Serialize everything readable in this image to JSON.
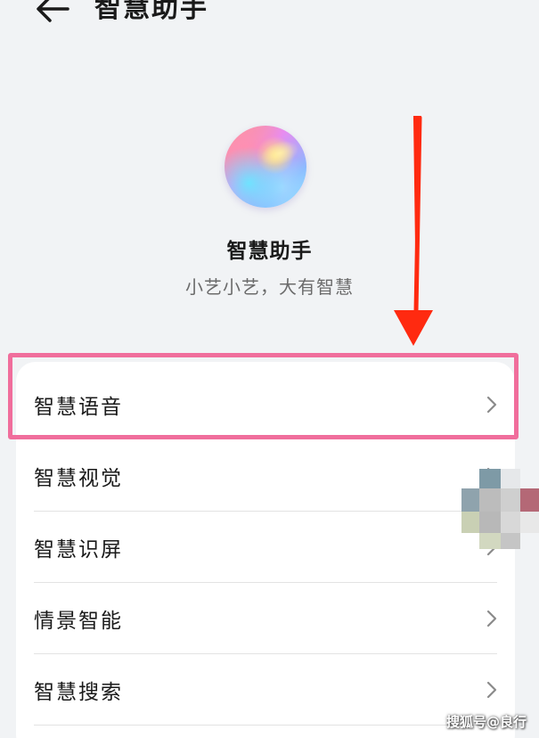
{
  "header": {
    "title": "智慧助手",
    "back_icon": "arrow-left-icon"
  },
  "app": {
    "name": "智慧助手",
    "subtitle": "小艺小艺，大有智慧",
    "logo_icon": "celia-orb-logo"
  },
  "menu": {
    "items": [
      {
        "label": "智慧语音",
        "highlighted": true
      },
      {
        "label": "智慧视觉"
      },
      {
        "label": "智慧识屏"
      },
      {
        "label": "情景智能"
      },
      {
        "label": "智慧搜索"
      }
    ],
    "chevron_icon": "chevron-right-icon"
  },
  "annotations": {
    "arrow_color": "#ff2a10",
    "highlight_color": "#f06e9c"
  },
  "watermark": "搜狐号@良行",
  "colors": {
    "background": "#f1f3f5",
    "card": "#ffffff",
    "subtitle_text": "#6b6b6b"
  }
}
